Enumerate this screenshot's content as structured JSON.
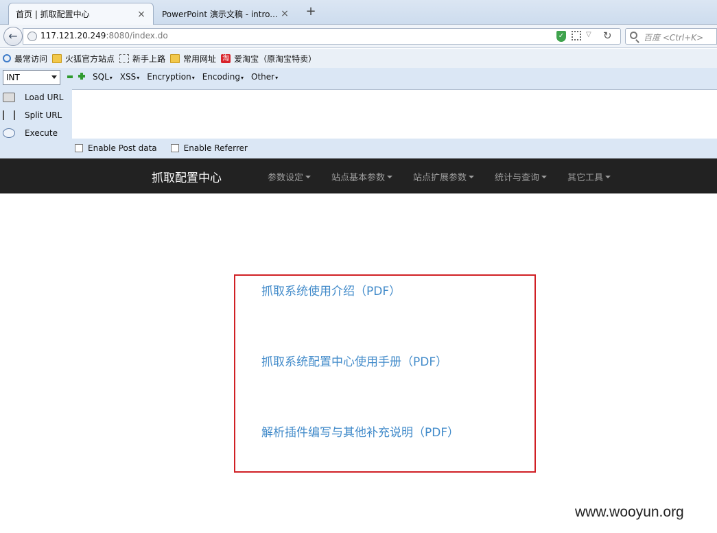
{
  "browser": {
    "tabs": [
      {
        "label": "首页 | 抓取配置中心",
        "active": true
      },
      {
        "label": "PowerPoint 演示文稿 - intro...",
        "active": false
      }
    ],
    "tab_close": "×",
    "new_tab": "+",
    "back": "←",
    "url_host": "117.121.20.249",
    "url_rest": ":8080/index.do",
    "reload": "↻",
    "search_placeholder": "百度 <Ctrl+K>"
  },
  "bookmarks": [
    {
      "label": "最常访问",
      "icon": "search-icon"
    },
    {
      "label": "火狐官方站点",
      "icon": "folder-icon"
    },
    {
      "label": "新手上路",
      "icon": "dashed-page-icon"
    },
    {
      "label": "常用网址",
      "icon": "folder-icon"
    },
    {
      "label": "爱淘宝（原淘宝特卖）",
      "icon": "taobao-icon",
      "icon_text": "淘"
    }
  ],
  "hackbar": {
    "select_value": "INT",
    "menus": [
      "SQL",
      "XSS",
      "Encryption",
      "Encoding",
      "Other"
    ],
    "menu_arrow": "▾",
    "buttons": [
      "Load URL",
      "Split URL",
      "Execute"
    ],
    "checks": [
      "Enable Post data",
      "Enable Referrer"
    ]
  },
  "site": {
    "brand": "抓取配置中心",
    "menus": [
      "参数设定",
      "站点基本参数",
      "站点扩展参数",
      "统计与查询",
      "其它工具"
    ],
    "links": [
      "抓取系统使用介绍（PDF）",
      "抓取系统配置中心使用手册（PDF）",
      "解析插件编写与其他补充说明（PDF）"
    ]
  },
  "watermark": "www.wooyun.org",
  "colors": {
    "navbar_bg": "#222222",
    "link": "#428bca",
    "highlight_box": "#d01f24"
  }
}
